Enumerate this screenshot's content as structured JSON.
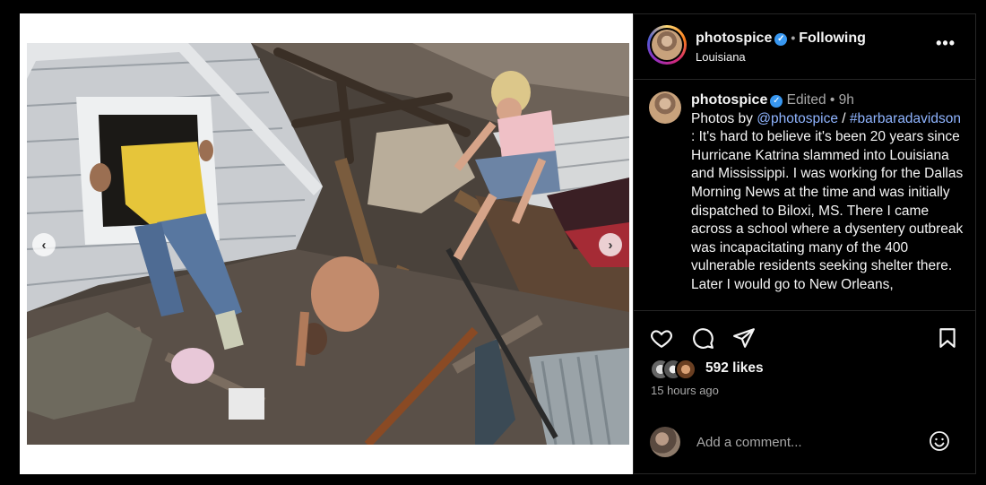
{
  "post": {
    "username": "photospice",
    "follow_status": "Following",
    "location": "Louisiana",
    "separator": "•"
  },
  "caption": {
    "username": "photospice",
    "edited": "Edited",
    "age": "9h",
    "lead": "Photos by ",
    "mention": "@photospice",
    "slash": " / ",
    "hashtag": "#barbaradavidson",
    "body": " :  It's hard to believe it's been 20 years since Hurricane Katrina slammed into Louisiana and Mississippi. I was working for the Dallas Morning News at the time and was initially dispatched to Biloxi, MS. There I came across a school where a dysentery outbreak was incapacitating many of the 400 vulnerable residents seeking shelter there. Later I would go to New Orleans,"
  },
  "engagement": {
    "likes": "592 likes",
    "time": "15 hours ago"
  },
  "comment": {
    "placeholder": "Add a comment..."
  },
  "icons": {
    "prev": "chevron-left-icon",
    "next": "chevron-right-icon",
    "more": "more-horizontal-icon",
    "like": "heart-icon",
    "comment": "comment-bubble-icon",
    "share": "paper-plane-icon",
    "save": "bookmark-icon",
    "emoji": "emoji-smiley-icon"
  },
  "colors": {
    "background": "#000000",
    "verified": "#3897f0",
    "link": "#8fb4ff",
    "muted": "#a8a8a8"
  }
}
